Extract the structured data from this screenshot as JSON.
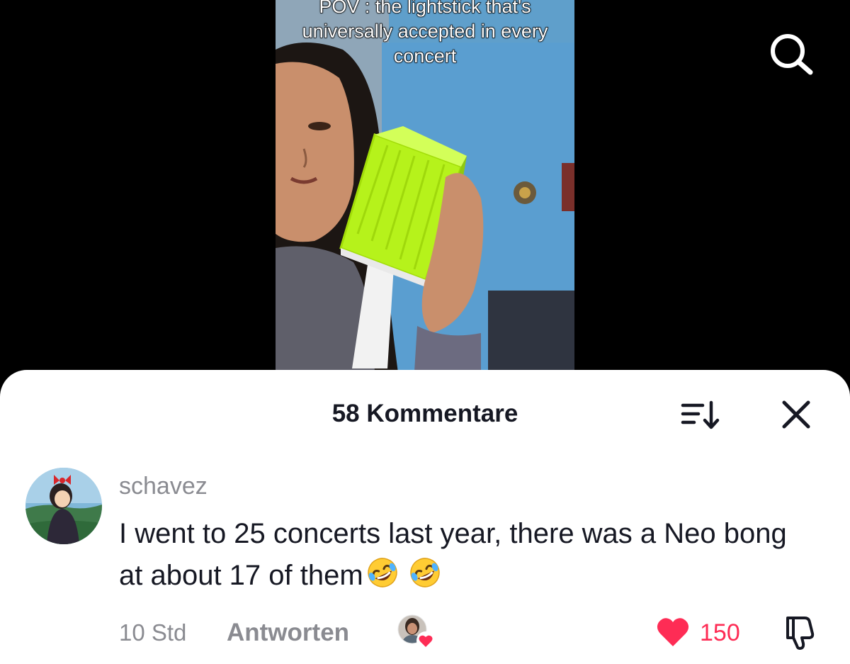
{
  "video": {
    "caption": "POV : the lightstick that's\nuniversally accepted in every\nconcert"
  },
  "top_bar": {
    "search_icon": "search-icon"
  },
  "comments": {
    "title": "58 Kommentare",
    "sort_icon": "sort-icon",
    "close_icon": "close-icon",
    "items": [
      {
        "username": "schavez",
        "text": "I went to 25 concerts last year, there was a Neo bong at about 17 of them",
        "emojis": [
          "rofl-emoji",
          "rofl-emoji"
        ],
        "time": "10 Std",
        "reply_label": "Antworten",
        "creator_liked": true,
        "like_count": "150",
        "liked": true
      }
    ]
  },
  "colors": {
    "like_red": "#fe2c55",
    "text_primary": "#161823",
    "text_secondary": "#8a8b91",
    "lightstick_green": "#b6f21b"
  }
}
